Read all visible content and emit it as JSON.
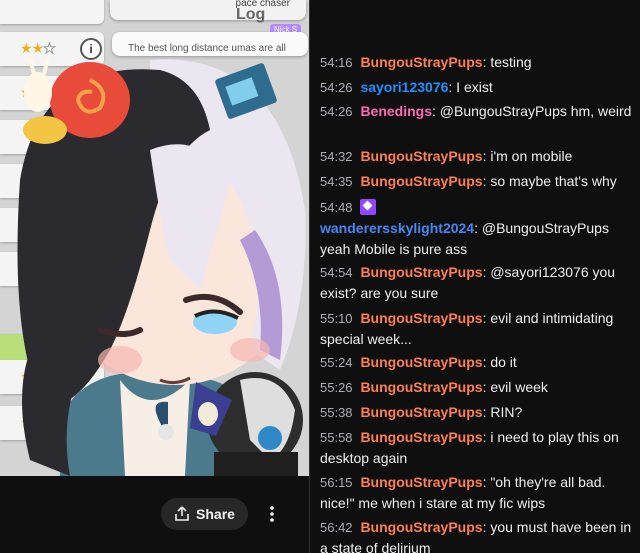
{
  "video": {
    "pace_label": "pace chaser",
    "log_label": "Log",
    "nick_badge": "Nick S",
    "preview_text": "The best long distance umas are all"
  },
  "controls": {
    "share_label": "Share"
  },
  "colors": {
    "orange": "#ff7f50",
    "blue": "#1e90ff",
    "pink": "#ff69b4",
    "username_blue": "#4287f5",
    "badge": "#9147ff"
  },
  "chat": {
    "messages": [
      {
        "time": "54:16",
        "user": "BungouStrayPups",
        "text": ": testing"
      },
      {
        "time": "54:26",
        "user": "sayori123076",
        "text": ": I exist"
      },
      {
        "time": "54:26",
        "user": "Benedings",
        "text": ": @BungouStrayPups hm, weird"
      },
      {
        "time": "54:32",
        "user": "BungouStrayPups",
        "text": ": i'm on mobile"
      },
      {
        "time": "54:35",
        "user": "BungouStrayPups",
        "text": ": so maybe that's why"
      },
      {
        "time": "54:48",
        "user": "wanderersskylight2024",
        "text": ": @BungouStrayPups yeah Mobile is pure ass"
      },
      {
        "time": "54:54",
        "user": "BungouStrayPups",
        "text": ": @sayori123076 you exist? are you sure"
      },
      {
        "time": "55:10",
        "user": "BungouStrayPups",
        "text": ": evil and intimidating special week..."
      },
      {
        "time": "55:24",
        "user": "BungouStrayPups",
        "text": ": do it"
      },
      {
        "time": "55:26",
        "user": "BungouStrayPups",
        "text": ": evil week"
      },
      {
        "time": "55:38",
        "user": "BungouStrayPups",
        "text": ": RIN?"
      },
      {
        "time": "55:58",
        "user": "BungouStrayPups",
        "text": ": i need to play this on desktop again"
      },
      {
        "time": "56:15",
        "user": "BungouStrayPups",
        "text": ": \"oh they're all bad. nice!\" me when i stare at my fic wips"
      },
      {
        "time": "56:42",
        "user": "BungouStrayPups",
        "text": ": you must have been in a state of delirium"
      }
    ]
  }
}
